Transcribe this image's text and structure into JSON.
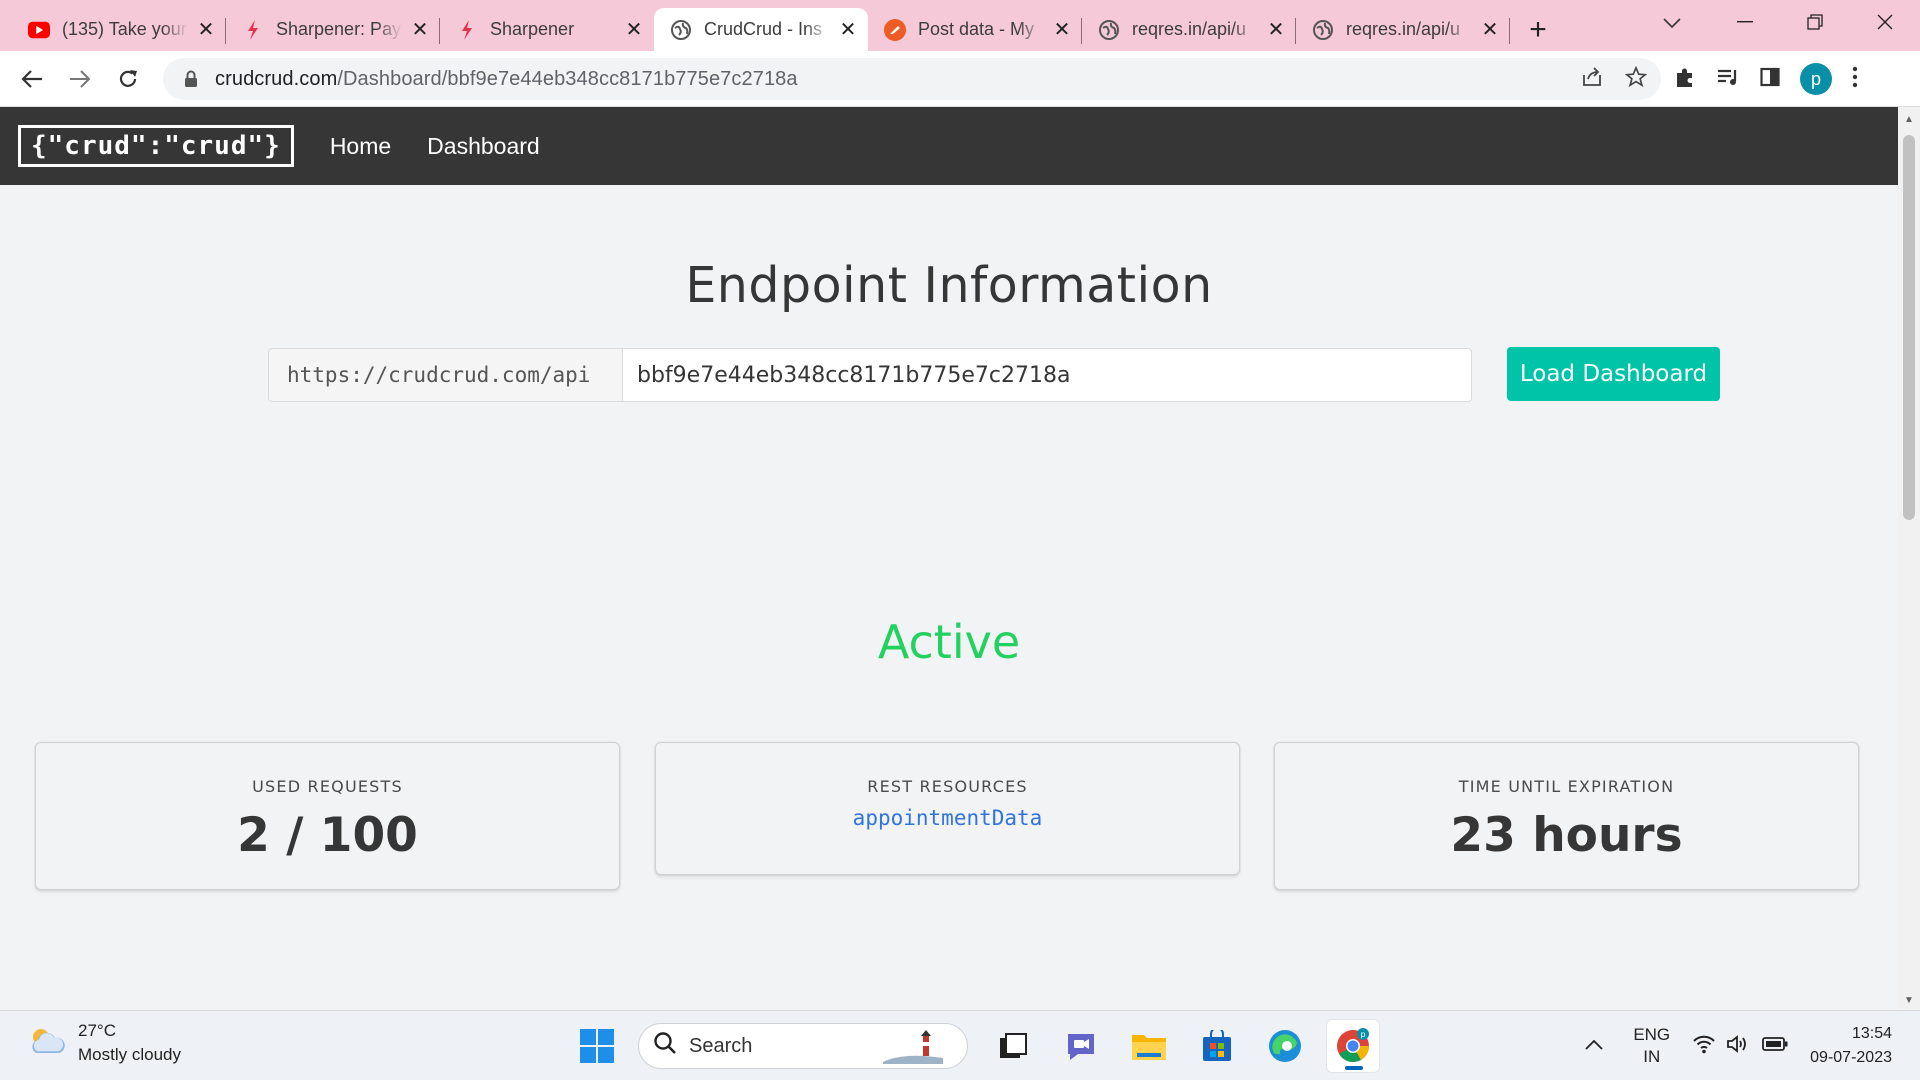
{
  "browser": {
    "tabs": [
      {
        "title": "(135) Take your",
        "favicon": "youtube-icon"
      },
      {
        "title": "Sharpener: Pay",
        "favicon": "sharpener-bolt-icon"
      },
      {
        "title": "Sharpener",
        "favicon": "sharpener-bolt-icon"
      },
      {
        "title": "CrudCrud - Ins",
        "favicon": "globe-icon",
        "active": true
      },
      {
        "title": "Post data - My",
        "favicon": "postman-icon"
      },
      {
        "title": "reqres.in/api/u",
        "favicon": "globe-icon"
      },
      {
        "title": "reqres.in/api/u",
        "favicon": "globe-icon"
      }
    ],
    "new_tab_label": "+",
    "address": {
      "host": "crudcrud.com",
      "path": "/Dashboard/bbf9e7e44eb348cc8171b775e7c2718a"
    },
    "profile_initial": "p",
    "colors": {
      "tabstrip": "#f6c9d8",
      "profile": "#0a8fa8"
    }
  },
  "site": {
    "brand": "{\"crud\":\"crud\"}",
    "nav": {
      "home": "Home",
      "dashboard": "Dashboard"
    }
  },
  "main": {
    "title": "Endpoint Information",
    "endpoint_prefix": "https://crudcrud.com/api",
    "endpoint_id": "bbf9e7e44eb348cc8171b775e7c2718a",
    "load_button": "Load Dashboard",
    "status": "Active",
    "cards": {
      "used_requests": {
        "heading": "USED REQUESTS",
        "value": "2 / 100"
      },
      "rest_resources": {
        "heading": "REST RESOURCES",
        "items": [
          "appointmentData"
        ]
      },
      "expiration": {
        "heading": "TIME UNTIL EXPIRATION",
        "value": "23 hours"
      }
    },
    "colors": {
      "accent": "#00c4a7",
      "status": "#23d160",
      "link": "#3273dc",
      "navbar": "#363636"
    }
  },
  "taskbar": {
    "weather": {
      "temp": "27°C",
      "desc": "Mostly cloudy"
    },
    "search_label": "Search",
    "language": {
      "line1": "ENG",
      "line2": "IN"
    },
    "time": "13:54",
    "date": "09-07-2023"
  }
}
